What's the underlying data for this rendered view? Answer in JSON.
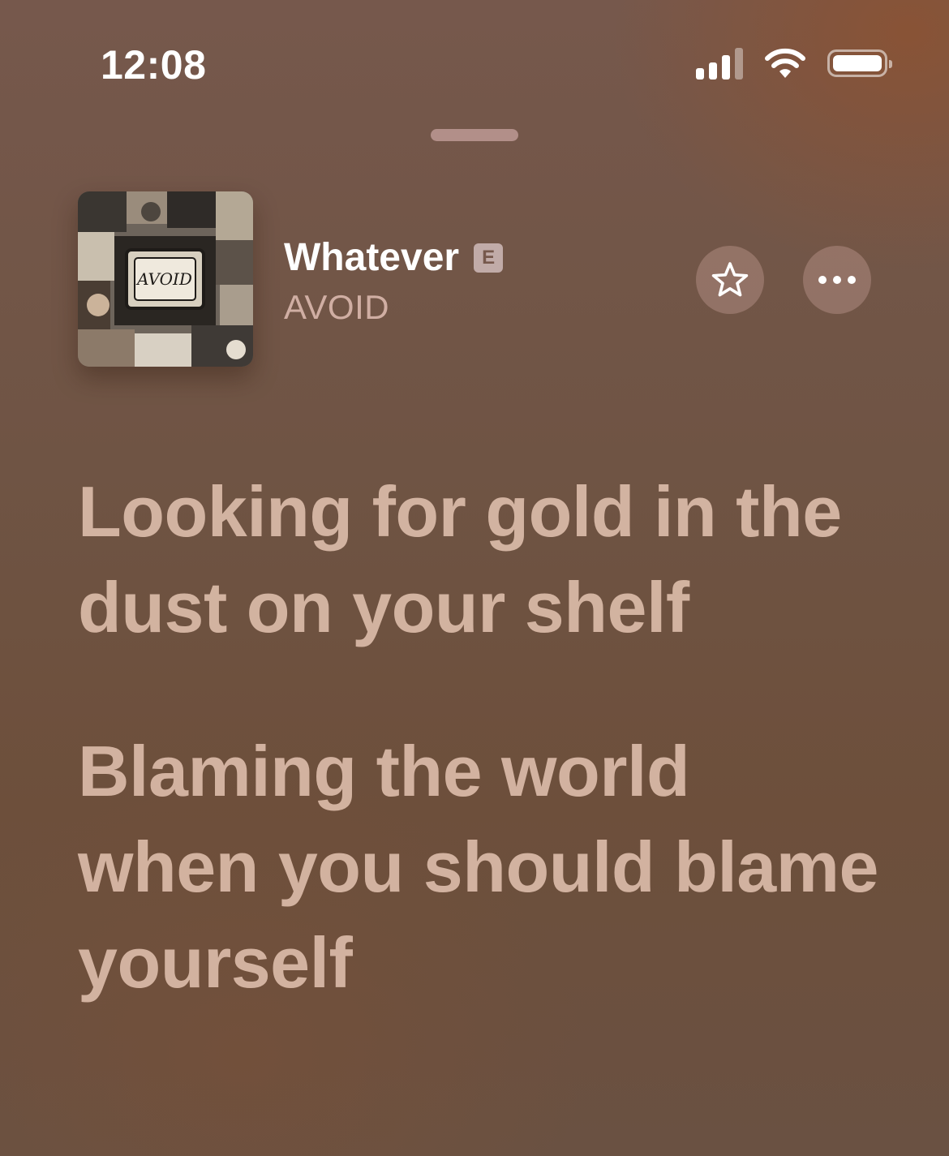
{
  "status_bar": {
    "time": "12:08",
    "icons": [
      "cellular-signal-icon",
      "wifi-icon",
      "battery-icon"
    ]
  },
  "now_playing": {
    "artwork_icon": "album-artwork",
    "title": "Whatever",
    "explicit_badge": "E",
    "artist": "AVOID",
    "favorite_icon": "star-icon",
    "more_icon": "ellipsis-icon"
  },
  "lyrics": {
    "lines": [
      "Looking for gold in the dust on your shelf",
      "Blaming the world when you should blame yourself"
    ]
  },
  "colors": {
    "background": "#6f5444",
    "lyric_text": "#e8c8b6",
    "title_text": "#ffffff",
    "artist_text": "#ebc8be"
  }
}
